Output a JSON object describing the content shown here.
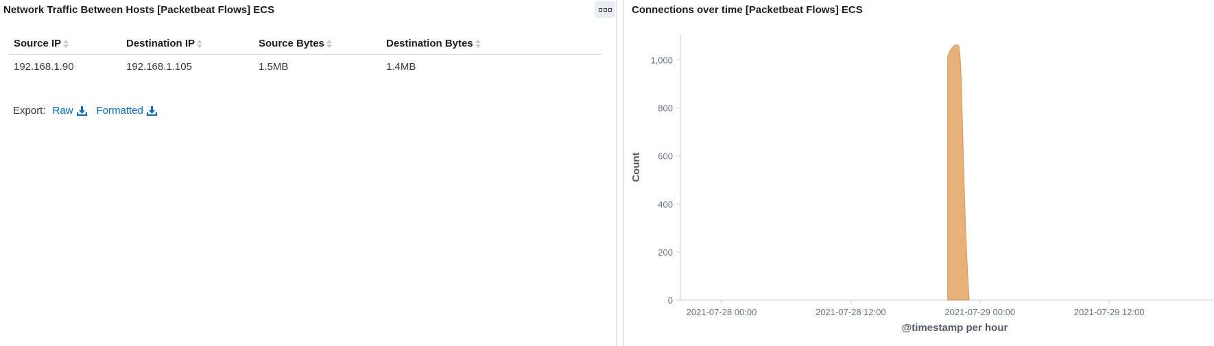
{
  "left_panel": {
    "title": "Network Traffic Between Hosts [Packetbeat Flows] ECS",
    "table": {
      "columns": [
        "Source IP",
        "Destination IP",
        "Source Bytes",
        "Destination Bytes"
      ],
      "rows": [
        [
          "192.168.1.90",
          "192.168.1.105",
          "1.5MB",
          "1.4MB"
        ]
      ]
    },
    "export": {
      "label": "Export:",
      "raw": "Raw",
      "formatted": "Formatted"
    }
  },
  "right_panel": {
    "title": "Connections over time [Packetbeat Flows] ECS"
  },
  "chart_data": {
    "type": "area",
    "title": "Connections over time [Packetbeat Flows] ECS",
    "xlabel": "@timestamp per hour",
    "ylabel": "Count",
    "x_ticks": [
      "2021-07-28 00:00",
      "2021-07-28 12:00",
      "2021-07-29 00:00",
      "2021-07-29 12:00"
    ],
    "y_ticks": [
      0,
      200,
      400,
      600,
      800,
      "1,000"
    ],
    "ylim": [
      0,
      1100
    ],
    "series": [
      {
        "color": "#e7b17a",
        "x": [
          "2021-07-28 21:00",
          "2021-07-28 22:00",
          "2021-07-28 23:00"
        ],
        "values": [
          1015,
          1060,
          0
        ]
      }
    ]
  },
  "colors": {
    "area_fill": "#e7b17a",
    "area_stroke": "#d29557",
    "link": "#006bb8"
  }
}
